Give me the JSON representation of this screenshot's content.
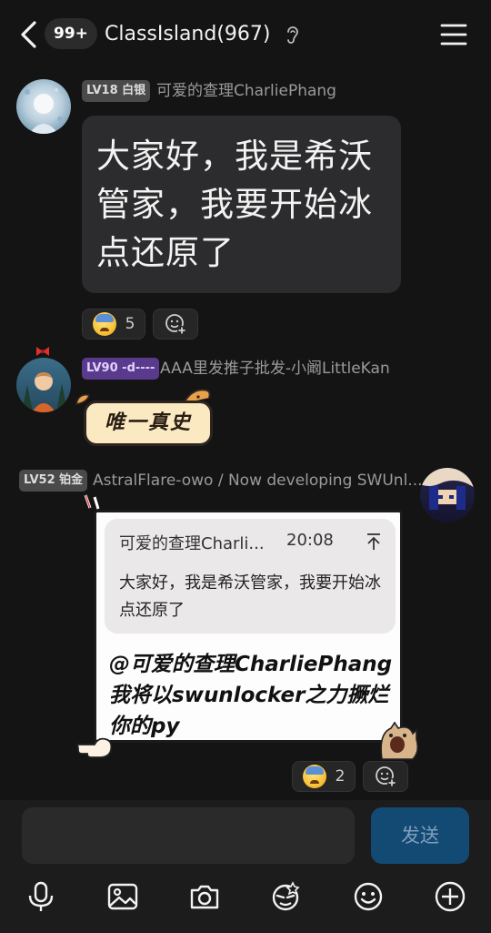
{
  "header": {
    "unread_badge": "99+",
    "title": "ClassIsland(967)"
  },
  "messages": [
    {
      "level": "LV18 白银",
      "nickname": "可爱的查理CharliePhang",
      "text": "大家好，我是希沃管家，我要开始冰点还原了",
      "reaction_count": "5"
    },
    {
      "level": "LV90 -d----",
      "nickname": "AAA里发推子批发-小阚LittleKan",
      "sticker_text": "唯一真史"
    },
    {
      "level": "LV52 铂金",
      "nickname": "AstralFlare-owo / Now developing SWUnl...",
      "quote": {
        "name": "可爱的查理Charli...",
        "time": "20:08",
        "text": "大家好，我是希沃管家，我要开始冰点还原了"
      },
      "reply": "@可爱的查理CharliePhang 我将以swunlocker之力撅烂你的py",
      "reaction_count": "2"
    }
  ],
  "composer": {
    "send_label": "发送"
  },
  "toolbar": [
    "mic-icon",
    "image-icon",
    "camera-icon",
    "sticker-face-icon",
    "emoji-icon",
    "plus-icon"
  ],
  "colors": {
    "background": "#141414",
    "bubble": "#2c2c2e",
    "send_button": "#134a73",
    "level_silver": "#4a4a4a",
    "level_purple": "#5a3a8c",
    "level_platinum": "#4a4a4a"
  }
}
